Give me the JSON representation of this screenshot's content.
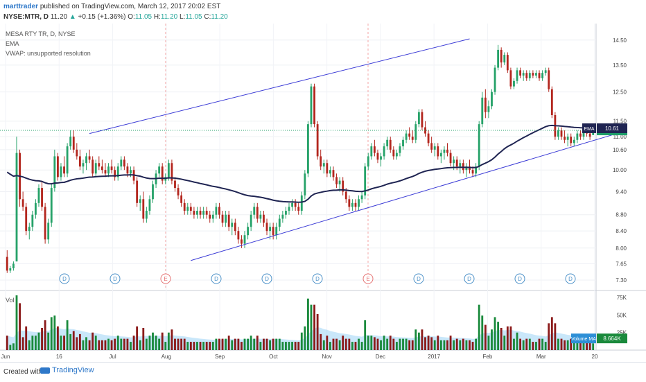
{
  "header": {
    "author": "marttrader",
    "published": "published on TradingView.com, March 12, 2017 20:02 EST",
    "symbol": "NYSE:MTR, D",
    "last": "11.20",
    "change_arrow": "▲",
    "change": "+0.15 (+1.36%)",
    "o_label": "O:",
    "o_value": "11.05",
    "h_label": "H:",
    "h_value": "11.20",
    "l_label": "L:",
    "l_value": "11.05",
    "c_label": "C:",
    "c_value": "11.20"
  },
  "legend": {
    "title": "MESA RTY TR, D, NYSE",
    "ema": "EMA",
    "vwap": "VWAP: unsupported resolution"
  },
  "vol_label": "Vol",
  "footer": {
    "created": "Created with",
    "brand": "TradingView"
  },
  "chart_data": {
    "type": "candlestick",
    "colors": {
      "up": "#26a269",
      "down": "#b3261e",
      "ema": "#1f2452",
      "trendline": "#3c3cd6",
      "vol_up": "#1a8a3c",
      "vol_down": "#8b1a1a",
      "vol_ma": "#9dd3f5"
    },
    "y_ticks": [
      "14.50",
      "13.50",
      "12.50",
      "11.50",
      "11.00",
      "10.60",
      "10.00",
      "9.40",
      "8.80",
      "8.40",
      "8.00",
      "7.65",
      "7.30"
    ],
    "x_ticks": [
      "Jun",
      "16",
      "Jul",
      "Aug",
      "Sep",
      "Oct",
      "Nov",
      "Dec",
      "2017",
      "Feb",
      "Mar",
      "20"
    ],
    "vol_ticks": [
      "75K",
      "50K",
      "25K"
    ],
    "last_price_label": "11.20",
    "ema_label": "EMA",
    "ema_value": "10.61",
    "vol_ma_label": "Volume MA",
    "vol_ma_value": "8.664K",
    "event_markers": [
      "D",
      "D",
      "E",
      "D",
      "D",
      "D",
      "E",
      "D",
      "D",
      "D",
      "D"
    ],
    "candles": [
      [
        "2016-06-01",
        7.8,
        7.95,
        7.45,
        7.5
      ],
      [
        "2016-06-02",
        7.5,
        7.6,
        7.45,
        7.55
      ],
      [
        "2016-06-03",
        7.55,
        7.7,
        7.5,
        7.65
      ],
      [
        "2016-06-06",
        7.7,
        11.0,
        7.7,
        10.5
      ],
      [
        "2016-06-07",
        10.5,
        10.6,
        9.0,
        9.2
      ],
      [
        "2016-06-08",
        9.2,
        9.4,
        8.9,
        9.0
      ],
      [
        "2016-06-09",
        9.0,
        9.1,
        8.3,
        8.4
      ],
      [
        "2016-06-10",
        8.4,
        8.6,
        8.2,
        8.5
      ],
      [
        "2016-06-13",
        8.5,
        8.9,
        8.4,
        8.8
      ],
      [
        "2016-06-14",
        8.8,
        9.2,
        8.7,
        9.1
      ],
      [
        "2016-06-15",
        9.1,
        9.6,
        9.0,
        9.5
      ],
      [
        "2016-06-16",
        9.5,
        9.7,
        8.9,
        9.0
      ],
      [
        "2016-06-17",
        9.0,
        9.1,
        8.1,
        8.2
      ],
      [
        "2016-06-20",
        8.2,
        8.7,
        8.1,
        8.6
      ],
      [
        "2016-06-21",
        8.6,
        9.6,
        8.5,
        9.5
      ],
      [
        "2016-06-22",
        9.5,
        10.6,
        9.4,
        10.4
      ],
      [
        "2016-06-23",
        10.4,
        10.5,
        9.7,
        9.8
      ],
      [
        "2016-06-24",
        9.8,
        10.2,
        9.7,
        10.1
      ],
      [
        "2016-06-27",
        10.1,
        10.4,
        9.8,
        9.9
      ],
      [
        "2016-06-28",
        9.9,
        10.8,
        9.8,
        10.7
      ],
      [
        "2016-06-29",
        10.7,
        11.2,
        10.6,
        11.0
      ],
      [
        "2016-06-30",
        11.0,
        11.2,
        10.5,
        10.6
      ],
      [
        "2016-07-01",
        10.6,
        10.8,
        10.3,
        10.4
      ],
      [
        "2016-07-05",
        10.4,
        10.6,
        10.0,
        10.1
      ],
      [
        "2016-07-06",
        10.1,
        10.3,
        9.9,
        10.2
      ],
      [
        "2016-07-07",
        10.2,
        10.5,
        10.0,
        10.4
      ],
      [
        "2016-07-08",
        10.4,
        10.6,
        10.2,
        10.3
      ],
      [
        "2016-07-11",
        10.3,
        10.4,
        9.8,
        9.9
      ],
      [
        "2016-07-12",
        9.9,
        10.3,
        9.8,
        10.2
      ],
      [
        "2016-07-13",
        10.2,
        10.4,
        10.0,
        10.1
      ],
      [
        "2016-07-14",
        10.1,
        10.3,
        9.9,
        10.0
      ],
      [
        "2016-07-15",
        10.0,
        10.2,
        9.8,
        9.9
      ],
      [
        "2016-07-18",
        9.9,
        10.2,
        9.8,
        10.1
      ],
      [
        "2016-07-19",
        10.1,
        10.3,
        9.9,
        10.0
      ],
      [
        "2016-07-20",
        10.0,
        10.1,
        9.7,
        9.8
      ],
      [
        "2016-07-21",
        9.8,
        10.2,
        9.7,
        10.1
      ],
      [
        "2016-07-22",
        10.1,
        10.4,
        10.0,
        10.3
      ],
      [
        "2016-07-25",
        10.3,
        10.4,
        10.0,
        10.1
      ],
      [
        "2016-07-26",
        10.1,
        10.2,
        9.8,
        9.9
      ],
      [
        "2016-07-27",
        9.9,
        10.1,
        9.8,
        10.0
      ],
      [
        "2016-07-28",
        10.0,
        10.1,
        9.6,
        9.7
      ],
      [
        "2016-07-29",
        9.7,
        9.8,
        9.0,
        9.1
      ],
      [
        "2016-08-01",
        9.1,
        9.3,
        8.9,
        9.2
      ],
      [
        "2016-08-02",
        9.2,
        9.4,
        8.6,
        8.7
      ],
      [
        "2016-08-03",
        8.7,
        9.0,
        8.6,
        8.9
      ],
      [
        "2016-08-04",
        8.9,
        9.3,
        8.8,
        9.2
      ],
      [
        "2016-08-05",
        9.2,
        9.7,
        9.1,
        9.6
      ],
      [
        "2016-08-08",
        9.6,
        10.0,
        9.5,
        9.9
      ],
      [
        "2016-08-09",
        9.9,
        10.2,
        9.8,
        10.1
      ],
      [
        "2016-08-10",
        10.1,
        10.2,
        9.6,
        9.7
      ],
      [
        "2016-08-11",
        9.7,
        9.9,
        9.6,
        9.8
      ],
      [
        "2016-08-12",
        9.8,
        10.3,
        9.7,
        10.2
      ],
      [
        "2016-08-15",
        10.2,
        10.3,
        9.6,
        9.7
      ],
      [
        "2016-08-16",
        9.7,
        9.8,
        9.4,
        9.5
      ],
      [
        "2016-08-17",
        9.5,
        9.6,
        9.2,
        9.3
      ],
      [
        "2016-08-18",
        9.3,
        9.4,
        9.0,
        9.1
      ],
      [
        "2016-08-19",
        9.1,
        9.2,
        8.8,
        8.9
      ],
      [
        "2016-08-22",
        8.9,
        9.1,
        8.8,
        9.0
      ],
      [
        "2016-08-23",
        9.0,
        9.1,
        8.8,
        8.9
      ],
      [
        "2016-08-24",
        8.9,
        9.0,
        8.7,
        8.8
      ],
      [
        "2016-08-25",
        8.8,
        9.0,
        8.7,
        8.9
      ],
      [
        "2016-08-26",
        8.9,
        9.0,
        8.7,
        8.8
      ],
      [
        "2016-08-29",
        8.8,
        9.0,
        8.7,
        8.9
      ],
      [
        "2016-08-30",
        8.9,
        9.0,
        8.7,
        8.8
      ],
      [
        "2016-08-31",
        8.8,
        8.9,
        8.6,
        8.7
      ],
      [
        "2016-09-01",
        8.7,
        8.9,
        8.6,
        8.8
      ],
      [
        "2016-09-02",
        8.8,
        9.1,
        8.7,
        9.0
      ],
      [
        "2016-09-06",
        9.0,
        9.1,
        8.7,
        8.8
      ],
      [
        "2016-09-07",
        8.8,
        8.9,
        8.5,
        8.6
      ],
      [
        "2016-09-08",
        8.6,
        8.9,
        8.5,
        8.8
      ],
      [
        "2016-09-09",
        8.8,
        8.9,
        8.4,
        8.5
      ],
      [
        "2016-09-12",
        8.5,
        8.7,
        8.3,
        8.6
      ],
      [
        "2016-09-13",
        8.6,
        8.7,
        8.3,
        8.4
      ],
      [
        "2016-09-14",
        8.4,
        8.5,
        8.1,
        8.2
      ],
      [
        "2016-09-15",
        8.2,
        8.3,
        8.0,
        8.1
      ],
      [
        "2016-09-16",
        8.1,
        8.4,
        8.0,
        8.3
      ],
      [
        "2016-09-19",
        8.3,
        8.6,
        8.2,
        8.5
      ],
      [
        "2016-09-20",
        8.5,
        8.9,
        8.4,
        8.8
      ],
      [
        "2016-09-21",
        8.8,
        9.1,
        8.7,
        9.0
      ],
      [
        "2016-09-22",
        9.0,
        9.1,
        8.6,
        8.7
      ],
      [
        "2016-09-23",
        8.7,
        8.9,
        8.6,
        8.8
      ],
      [
        "2016-09-26",
        8.8,
        8.9,
        8.5,
        8.6
      ],
      [
        "2016-09-27",
        8.6,
        8.7,
        8.3,
        8.4
      ],
      [
        "2016-09-28",
        8.4,
        8.6,
        8.2,
        8.5
      ],
      [
        "2016-09-29",
        8.5,
        8.6,
        8.2,
        8.3
      ],
      [
        "2016-09-30",
        8.3,
        8.6,
        8.2,
        8.5
      ],
      [
        "2016-10-03",
        8.5,
        8.8,
        8.4,
        8.7
      ],
      [
        "2016-10-04",
        8.7,
        8.9,
        8.6,
        8.8
      ],
      [
        "2016-10-05",
        8.8,
        9.0,
        8.7,
        8.9
      ],
      [
        "2016-10-06",
        8.9,
        9.1,
        8.8,
        9.0
      ],
      [
        "2016-10-07",
        9.0,
        9.2,
        8.9,
        9.1
      ],
      [
        "2016-10-10",
        9.1,
        9.2,
        8.9,
        9.0
      ],
      [
        "2016-10-11",
        9.0,
        9.1,
        8.8,
        8.9
      ],
      [
        "2016-10-12",
        8.9,
        9.4,
        8.8,
        9.3
      ],
      [
        "2016-10-13",
        9.3,
        10.0,
        9.2,
        9.9
      ],
      [
        "2016-10-14",
        9.9,
        11.5,
        9.8,
        11.4
      ],
      [
        "2016-10-17",
        11.4,
        12.8,
        11.3,
        12.7
      ],
      [
        "2016-10-18",
        12.7,
        12.8,
        11.3,
        11.4
      ],
      [
        "2016-10-19",
        11.4,
        11.5,
        10.3,
        10.4
      ],
      [
        "2016-10-20",
        10.4,
        10.6,
        10.0,
        10.1
      ],
      [
        "2016-10-21",
        10.1,
        10.3,
        9.9,
        10.2
      ],
      [
        "2016-10-24",
        10.2,
        10.3,
        9.8,
        9.9
      ],
      [
        "2016-10-25",
        9.9,
        10.1,
        9.8,
        10.0
      ],
      [
        "2016-10-26",
        10.0,
        10.1,
        9.7,
        9.8
      ],
      [
        "2016-10-27",
        9.8,
        9.9,
        9.5,
        9.6
      ],
      [
        "2016-10-28",
        9.6,
        9.8,
        9.4,
        9.7
      ],
      [
        "2016-10-31",
        9.7,
        9.8,
        9.3,
        9.4
      ],
      [
        "2016-11-01",
        9.4,
        9.5,
        9.1,
        9.2
      ],
      [
        "2016-11-02",
        9.2,
        9.3,
        8.9,
        9.0
      ],
      [
        "2016-11-03",
        9.0,
        9.2,
        8.9,
        9.1
      ],
      [
        "2016-11-04",
        9.1,
        9.2,
        8.9,
        9.0
      ],
      [
        "2016-11-07",
        9.0,
        9.3,
        8.9,
        9.2
      ],
      [
        "2016-11-08",
        9.2,
        9.4,
        9.1,
        9.3
      ],
      [
        "2016-11-09",
        9.3,
        10.2,
        9.2,
        10.1
      ],
      [
        "2016-11-10",
        10.1,
        10.5,
        10.0,
        10.4
      ],
      [
        "2016-11-11",
        10.4,
        10.8,
        10.3,
        10.7
      ],
      [
        "2016-11-14",
        10.7,
        10.9,
        10.4,
        10.5
      ],
      [
        "2016-11-15",
        10.5,
        10.6,
        10.2,
        10.3
      ],
      [
        "2016-11-16",
        10.3,
        10.5,
        10.1,
        10.4
      ],
      [
        "2016-11-17",
        10.4,
        10.8,
        10.3,
        10.7
      ],
      [
        "2016-11-18",
        10.7,
        11.0,
        10.6,
        10.9
      ],
      [
        "2016-11-21",
        10.9,
        11.0,
        10.5,
        10.6
      ],
      [
        "2016-11-22",
        10.6,
        10.7,
        10.3,
        10.4
      ],
      [
        "2016-11-23",
        10.4,
        10.6,
        10.3,
        10.5
      ],
      [
        "2016-11-25",
        10.5,
        10.8,
        10.4,
        10.7
      ],
      [
        "2016-11-28",
        10.7,
        11.0,
        10.6,
        10.9
      ],
      [
        "2016-11-29",
        10.9,
        11.2,
        10.8,
        11.1
      ],
      [
        "2016-11-30",
        11.1,
        11.3,
        10.9,
        11.0
      ],
      [
        "2016-12-01",
        11.0,
        11.2,
        10.8,
        10.9
      ],
      [
        "2016-12-02",
        10.9,
        11.5,
        10.8,
        11.4
      ],
      [
        "2016-12-05",
        11.4,
        11.9,
        11.3,
        11.8
      ],
      [
        "2016-12-06",
        11.8,
        11.9,
        11.2,
        11.3
      ],
      [
        "2016-12-07",
        11.3,
        11.5,
        11.0,
        11.1
      ],
      [
        "2016-12-08",
        11.1,
        11.2,
        10.7,
        10.8
      ],
      [
        "2016-12-09",
        10.8,
        11.0,
        10.5,
        10.6
      ],
      [
        "2016-12-12",
        10.6,
        10.8,
        10.4,
        10.7
      ],
      [
        "2016-12-13",
        10.7,
        10.8,
        10.3,
        10.4
      ],
      [
        "2016-12-14",
        10.4,
        10.6,
        10.2,
        10.5
      ],
      [
        "2016-12-15",
        10.5,
        10.7,
        10.3,
        10.6
      ],
      [
        "2016-12-16",
        10.6,
        10.8,
        10.4,
        10.5
      ],
      [
        "2016-12-19",
        10.5,
        10.6,
        10.1,
        10.2
      ],
      [
        "2016-12-20",
        10.2,
        10.4,
        10.0,
        10.3
      ],
      [
        "2016-12-21",
        10.3,
        10.4,
        10.0,
        10.1
      ],
      [
        "2016-12-22",
        10.1,
        10.3,
        9.9,
        10.2
      ],
      [
        "2016-12-23",
        10.2,
        10.3,
        9.9,
        10.0
      ],
      [
        "2016-12-27",
        10.0,
        10.2,
        9.8,
        10.1
      ],
      [
        "2016-12-28",
        10.1,
        10.3,
        9.9,
        10.0
      ],
      [
        "2016-12-29",
        10.0,
        10.1,
        9.8,
        9.9
      ],
      [
        "2016-12-30",
        9.9,
        10.2,
        9.8,
        10.1
      ],
      [
        "2017-01-03",
        10.1,
        11.5,
        10.0,
        11.4
      ],
      [
        "2017-01-04",
        11.4,
        12.5,
        11.3,
        12.3
      ],
      [
        "2017-01-05",
        12.3,
        12.6,
        11.6,
        11.8
      ],
      [
        "2017-01-06",
        11.8,
        12.2,
        11.6,
        12.0
      ],
      [
        "2017-01-09",
        12.0,
        12.6,
        11.9,
        12.5
      ],
      [
        "2017-01-10",
        12.5,
        13.5,
        12.4,
        13.4
      ],
      [
        "2017-01-11",
        13.4,
        14.3,
        13.3,
        14.1
      ],
      [
        "2017-01-12",
        14.1,
        14.2,
        13.4,
        13.6
      ],
      [
        "2017-01-13",
        13.6,
        14.0,
        13.5,
        13.9
      ],
      [
        "2017-01-17",
        13.9,
        14.0,
        13.2,
        13.3
      ],
      [
        "2017-01-18",
        13.3,
        13.4,
        12.6,
        12.7
      ],
      [
        "2017-01-19",
        12.7,
        13.0,
        12.6,
        12.9
      ],
      [
        "2017-01-20",
        12.9,
        13.4,
        12.8,
        13.3
      ],
      [
        "2017-01-23",
        13.3,
        13.4,
        13.0,
        13.1
      ],
      [
        "2017-01-24",
        13.1,
        13.3,
        12.9,
        13.2
      ],
      [
        "2017-01-25",
        13.2,
        13.3,
        12.9,
        13.0
      ],
      [
        "2017-01-26",
        13.0,
        13.3,
        12.9,
        13.2
      ],
      [
        "2017-01-27",
        13.2,
        13.3,
        13.0,
        13.1
      ],
      [
        "2017-01-30",
        13.1,
        13.3,
        13.0,
        13.2
      ],
      [
        "2017-01-31",
        13.2,
        13.3,
        12.9,
        13.0
      ],
      [
        "2017-02-01",
        13.0,
        13.3,
        12.9,
        13.2
      ],
      [
        "2017-02-02",
        13.2,
        13.4,
        13.1,
        13.3
      ],
      [
        "2017-02-03",
        13.3,
        13.4,
        12.5,
        12.6
      ],
      [
        "2017-02-06",
        12.6,
        12.7,
        11.6,
        11.7
      ],
      [
        "2017-02-07",
        11.7,
        11.8,
        10.9,
        11.0
      ],
      [
        "2017-02-08",
        11.0,
        11.3,
        10.9,
        11.2
      ],
      [
        "2017-02-09",
        11.2,
        11.3,
        10.9,
        11.0
      ],
      [
        "2017-02-10",
        11.0,
        11.2,
        10.8,
        10.9
      ],
      [
        "2017-02-13",
        10.9,
        11.1,
        10.7,
        11.0
      ],
      [
        "2017-02-14",
        11.0,
        11.1,
        10.7,
        10.8
      ],
      [
        "2017-02-15",
        10.8,
        11.0,
        10.7,
        10.9
      ],
      [
        "2017-02-16",
        10.9,
        11.2,
        10.8,
        11.1
      ],
      [
        "2017-02-17",
        11.1,
        11.2,
        10.9,
        11.0
      ],
      [
        "2017-02-21",
        11.0,
        11.3,
        10.9,
        11.2
      ],
      [
        "2017-02-22",
        11.2,
        11.3,
        11.0,
        11.1
      ],
      [
        "2017-02-23",
        11.1,
        11.2,
        10.9,
        11.0
      ],
      [
        "2017-02-24",
        11.05,
        11.2,
        11.05,
        11.2
      ]
    ]
  }
}
